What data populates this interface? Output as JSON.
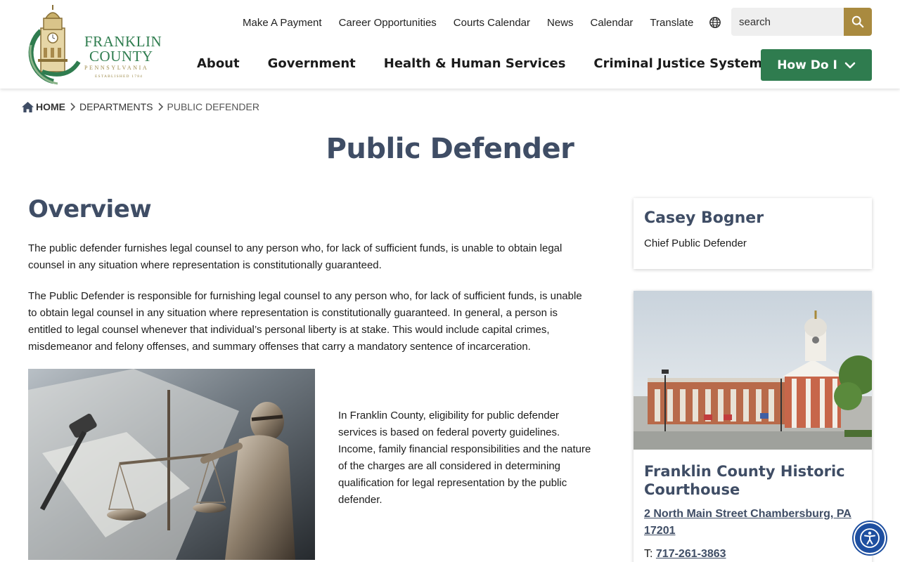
{
  "logo": {
    "line1": "FRANKLIN",
    "line2": "COUNTY",
    "line3": "PENNSYLVANIA",
    "line4": "ESTABLISHED 1784"
  },
  "utility_nav": {
    "items": [
      {
        "label": "Make A Payment"
      },
      {
        "label": "Career Opportunities"
      },
      {
        "label": "Courts Calendar"
      },
      {
        "label": "News"
      },
      {
        "label": "Calendar"
      },
      {
        "label": "Translate"
      }
    ],
    "globe_icon": "globe-icon"
  },
  "search": {
    "placeholder": "search",
    "button_icon": "search-icon"
  },
  "main_nav": {
    "items": [
      {
        "label": "About"
      },
      {
        "label": "Government"
      },
      {
        "label": "Health & Human Services"
      },
      {
        "label": "Criminal Justice System"
      }
    ],
    "how_do_i": "How Do I"
  },
  "breadcrumb": {
    "home": "HOME",
    "departments": "DEPARTMENTS",
    "current": "PUBLIC DEFENDER"
  },
  "page": {
    "title": "Public Defender",
    "overview_heading": "Overview",
    "paragraph_1": "The public defender furnishes legal counsel to any person who, for lack of sufficient funds, is unable to obtain legal counsel in any situation where representation is constitutionally guaranteed.",
    "paragraph_2": "The Public Defender is responsible for furnishing legal counsel to any person who, for lack of sufficient funds, is unable to obtain legal counsel in any situation where representation is constitutionally guaranteed. In general, a person is entitled to legal counsel whenever that individual’s personal liberty is at stake. This would include capital crimes, misdemeanor and felony offenses, and summary offenses that carry a mandatory sentence of incarceration.",
    "paragraph_3": "In Franklin County, eligibility for public defender services is based on federal poverty guidelines. Income, family financial responsibilities and the nature of the charges are all considered in determining qualification for legal representation by the public defender."
  },
  "contact_card": {
    "name": "Casey Bogner",
    "role": "Chief Public Defender"
  },
  "location_card": {
    "title": "Franklin County Historic Courthouse",
    "address": "2 North Main Street Chambersburg, PA 17201",
    "phone_prefix": "T:",
    "phone": "717-261-3863"
  },
  "colors": {
    "heading": "#3f4d65",
    "brand_green": "#2f7c4f",
    "gold": "#a98a3f"
  }
}
